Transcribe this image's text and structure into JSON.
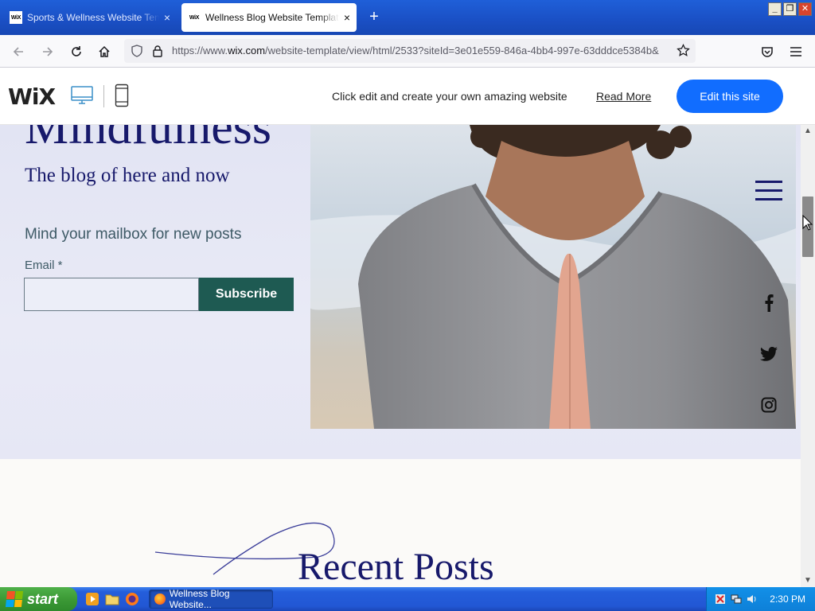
{
  "browser": {
    "tabs": [
      {
        "favicon": "WiX",
        "title": "Sports & Wellness Website Template | WIX",
        "close": "×"
      },
      {
        "favicon": "WiX",
        "title": "Wellness Blog Website Template | WIX",
        "close": "×"
      }
    ],
    "new_tab": "+",
    "window_controls": {
      "minimize": "_",
      "restore": "❐",
      "close": "✕"
    },
    "url": {
      "prefix": "https://www.",
      "domain": "wix.com",
      "rest": "/website-template/view/html/2533?siteId=3e01e559-846a-4bb4-997e-63dddce5384b&"
    }
  },
  "wix_bar": {
    "logo": "WiX",
    "message": "Click edit and create your own amazing website",
    "read_more": "Read More",
    "edit_button": "Edit this site"
  },
  "hero": {
    "title": "Mindfulness",
    "subtitle": "The blog of here and now",
    "mailbox_text": "Mind your mailbox for new posts",
    "email_label": "Email *",
    "email_value": "",
    "subscribe_label": "Subscribe"
  },
  "social": [
    "facebook",
    "twitter",
    "instagram"
  ],
  "recent_posts": {
    "title": "Recent Posts"
  },
  "taskbar": {
    "start_label": "start",
    "task_item": "Wellness Blog Website...",
    "clock": "2:30 PM"
  },
  "colors": {
    "brand_navy": "#17196b",
    "subscribe_green": "#1e5a52",
    "wix_blue": "#116dff"
  }
}
